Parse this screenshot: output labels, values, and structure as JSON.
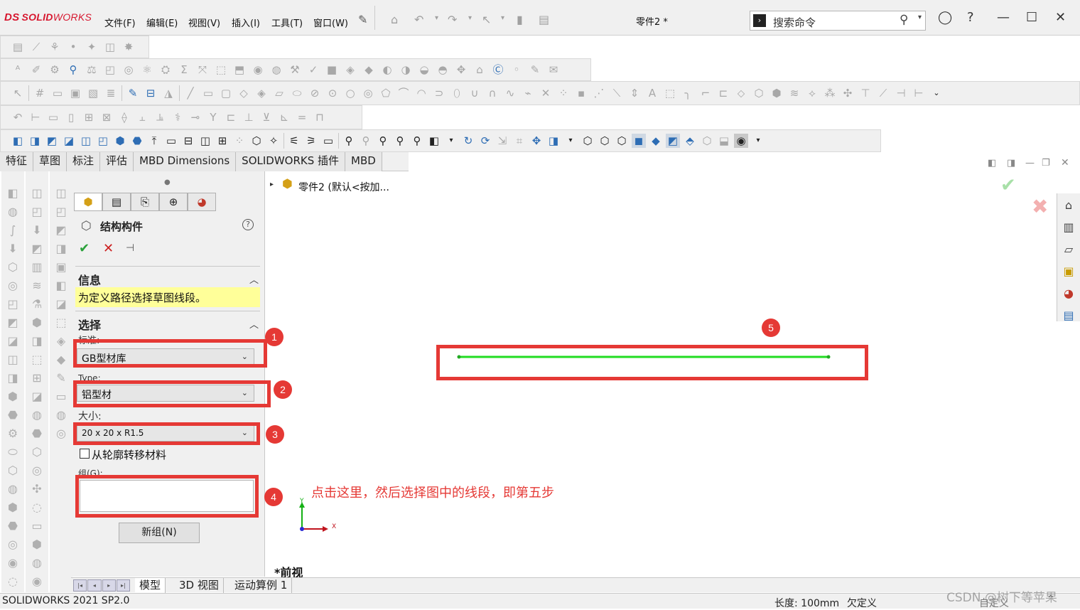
{
  "app": {
    "logo_ds": "DS",
    "logo_solid": "SOLID",
    "logo_works": "WORKS",
    "document_title": "零件2 *"
  },
  "menu": [
    "文件(F)",
    "编辑(E)",
    "视图(V)",
    "插入(I)",
    "工具(T)",
    "窗口(W)"
  ],
  "search": {
    "placeholder": "搜索命令"
  },
  "command_tabs": [
    "特征",
    "草图",
    "标注",
    "评估",
    "MBD Dimensions",
    "SOLIDWORKS 插件",
    "MBD"
  ],
  "feature_tree": {
    "root_label": "零件2 (默认<按加..."
  },
  "property_manager": {
    "title": "结构构件",
    "info": {
      "header": "信息",
      "message": "为定义路径选择草图线段。"
    },
    "selection": {
      "header": "选择",
      "standard_label": "标准:",
      "standard_value": "GB型材库",
      "type_label": "Type:",
      "type_value": "铝型材",
      "size_label": "大小:",
      "size_value": "20 x 20 x R1.5",
      "transfer_label": "从轮廓转移材料",
      "transfer_checked": false,
      "group_label": "组(G):",
      "new_group_button": "新组(N)"
    }
  },
  "annotations": {
    "step1": "1",
    "step2": "2",
    "step3": "3",
    "step4": "4",
    "step5": "5",
    "instruction": "点击这里，然后选择图中的线段，即第五步",
    "color": "#e53935"
  },
  "viewport": {
    "view_label": "*前视",
    "axis_x": "X",
    "axis_y": "Y",
    "sketch_line_color": "#22dd22"
  },
  "bottom_tabs": [
    "模型",
    "3D 视图",
    "运动算例 1"
  ],
  "statusbar": {
    "version": "SOLIDWORKS 2021 SP2.0",
    "length": "长度: 100mm",
    "state": "欠定义",
    "custom": "自定义",
    "watermark": "CSDN @树下等苹果"
  }
}
